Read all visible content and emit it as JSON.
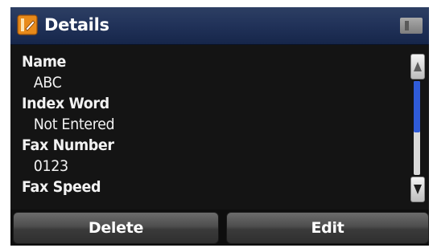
{
  "header": {
    "title": "Details",
    "app_icon": "contact-book-icon",
    "status_icon": "memory-card-icon"
  },
  "details": {
    "fields": [
      {
        "label": "Name",
        "value": "ABC"
      },
      {
        "label": "Index Word",
        "value": "Not Entered"
      },
      {
        "label": "Fax Number",
        "value": "0123"
      },
      {
        "label": "Fax Speed",
        "value": ""
      }
    ]
  },
  "scrollbar": {
    "up_icon": "arrow-up-icon",
    "down_icon": "arrow-down-icon",
    "position_fraction": 0.0,
    "visible_fraction": 0.55
  },
  "actions": {
    "delete_label": "Delete",
    "edit_label": "Edit"
  },
  "colors": {
    "titlebar": "#22335a",
    "background": "#141414",
    "scroll_thumb": "#2f5bd8",
    "app_icon_orange": "#e88a1a"
  }
}
